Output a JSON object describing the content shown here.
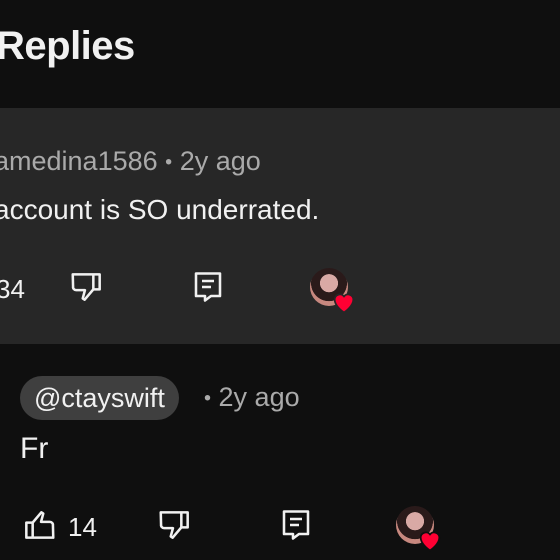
{
  "header": {
    "title": "Replies"
  },
  "parent_comment": {
    "author": "amedina1586",
    "separator": "•",
    "time": "2y ago",
    "text": "account is SO underrated.",
    "like_count": "34"
  },
  "reply": {
    "author": "@ctayswift",
    "separator": "•",
    "time": "2y ago",
    "text": "Fr",
    "like_count": "14"
  },
  "colors": {
    "heart": "#ff0033",
    "background": "#0f0f0f",
    "panel": "#272727",
    "pill": "#3f3f3f"
  }
}
